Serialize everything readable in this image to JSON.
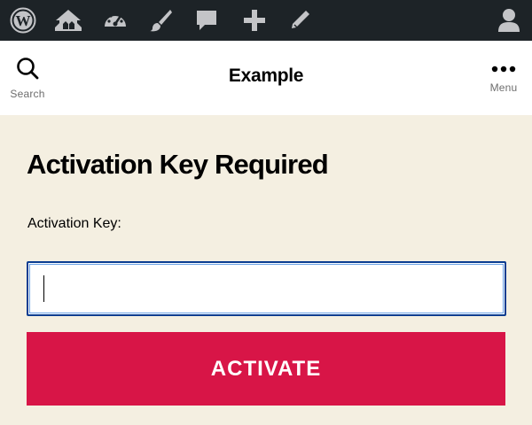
{
  "admin_bar": {
    "icons": [
      "wordpress-icon",
      "my-sites-icon",
      "dashboard-icon",
      "customize-icon",
      "comments-icon",
      "new-content-icon",
      "edit-icon",
      "user-avatar-icon"
    ]
  },
  "header": {
    "site_title": "Example",
    "search_label": "Search",
    "menu_label": "Menu"
  },
  "main": {
    "title": "Activation Key Required",
    "field_label": "Activation Key:",
    "input_value": "",
    "button_label": "ACTIVATE"
  },
  "colors": {
    "admin_bar_bg": "#1d2327",
    "page_bg": "#f4efe1",
    "accent": "#d81547"
  }
}
